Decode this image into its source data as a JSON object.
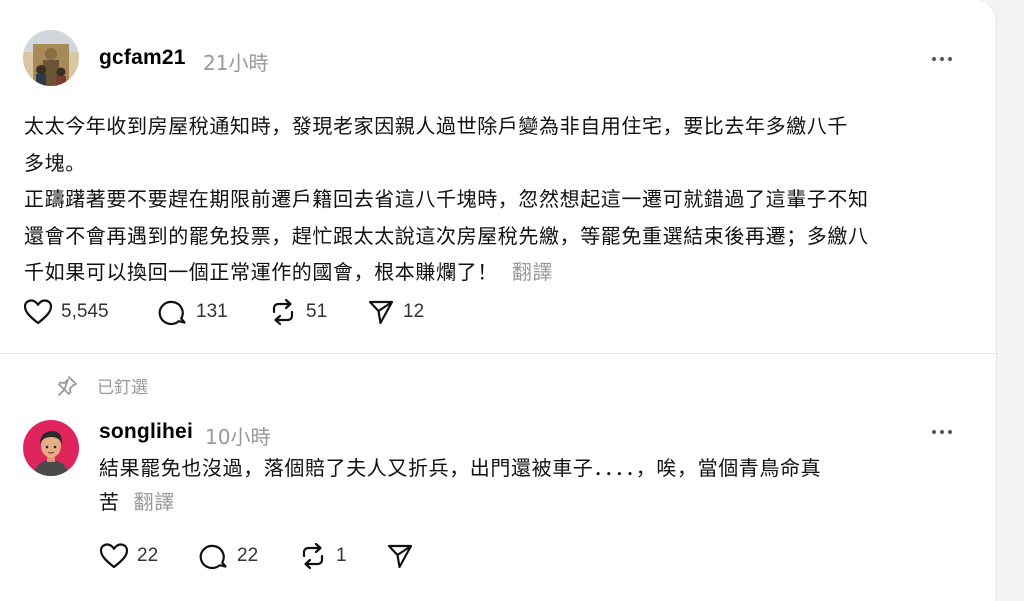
{
  "post": {
    "username": "gcfam21",
    "time": "21小時",
    "lines": [
      "太太今年收到房屋稅通知時，發現老家因親人過世除戶變為非自用住宅，要比去年多繳八千",
      "多塊。",
      "正躊躇著要不要趕在期限前遷戶籍回去省這八千塊時，忽然想起這一遷可就錯過了這輩子不知",
      "還會不會再遇到的罷免投票，趕忙跟太太說這次房屋稅先繳，等罷免重選結束後再遷；多繳八",
      "千如果可以換回一個正常運作的國會，根本賺爛了！"
    ],
    "translate_label": "翻譯",
    "likes": "5,545",
    "replies": "131",
    "reposts": "51",
    "shares": "12"
  },
  "pinned_label": "已釘選",
  "reply": {
    "username": "songlihei",
    "time": "10小時",
    "lines": [
      "結果罷免也沒過，落個賠了夫人又折兵，出門還被車子．．．．，唉，當個青鳥命真",
      "苦"
    ],
    "translate_label": "翻譯",
    "likes": "22",
    "replies": "22",
    "reposts": "1"
  },
  "icons": {
    "like": "heart-icon",
    "reply": "comment-icon",
    "repost": "repost-icon",
    "share": "send-icon",
    "more": "more-icon",
    "pin": "pin-icon"
  }
}
